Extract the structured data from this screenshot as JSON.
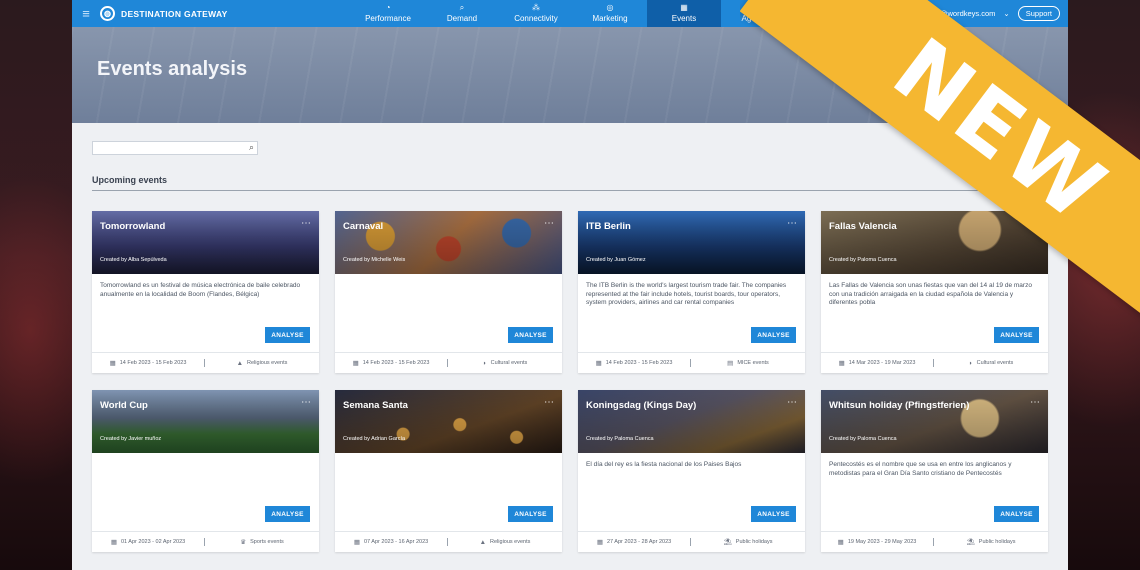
{
  "nav": {
    "brand": "DESTINATION GATEWAY",
    "items": [
      {
        "label": "Performance",
        "icon": "gauge-icon",
        "glyph": "◔"
      },
      {
        "label": "Demand",
        "icon": "search-icon",
        "glyph": "⌕"
      },
      {
        "label": "Connectivity",
        "icon": "network-icon",
        "glyph": "⁂"
      },
      {
        "label": "Marketing",
        "icon": "target-icon",
        "glyph": "◎"
      },
      {
        "label": "Events",
        "icon": "calendar-icon",
        "glyph": "▦"
      },
      {
        "label": "Agencies",
        "icon": "briefcase-icon",
        "glyph": "▤"
      }
    ],
    "active": "Events",
    "user_email": "info@wordkeys.com",
    "support_label": "Support"
  },
  "hero": {
    "title": "Events analysis"
  },
  "search": {
    "placeholder": "",
    "value": ""
  },
  "section": {
    "title": "Upcoming events"
  },
  "ribbon": {
    "text": "NEW",
    "color": "#f5b731"
  },
  "accent_color": "#1f87d8",
  "cards": [
    {
      "title": "Tomorrowland",
      "creator": "Created by Alba Sepúlveda",
      "desc": "Tomorrowland es un festival de música electrónica de baile celebrado anualmente en la localidad de Boom (Flandes, Bélgica)",
      "button": "ANALYSE",
      "date": "14 Feb 2023 - 15 Feb 2023",
      "category": "Religious events"
    },
    {
      "title": "Carnaval",
      "creator": "Created by Michelle Weis",
      "desc": "",
      "button": "ANALYSE",
      "date": "14 Feb 2023 - 15 Feb 2023",
      "category": "Cultural events"
    },
    {
      "title": "ITB Berlin",
      "creator": "Created by Juan Gómez",
      "desc": "The ITB Berlin is the world's largest tourism trade fair. The companies represented at the fair include hotels, tourist boards, tour operators, system providers, airlines and car rental companies",
      "button": "ANALYSE",
      "date": "14 Feb 2023 - 15 Feb 2023",
      "category": "MICE events"
    },
    {
      "title": "Fallas Valencia",
      "creator": "Created by Paloma Cuenca",
      "desc": "Las Fallas de Valencia son unas fiestas que van del 14 al 19 de marzo con una tradición arraigada en la ciudad española de Valencia y diferentes pobla",
      "button": "ANALYSE",
      "date": "14 Mar 2023 - 19 Mar 2023",
      "category": "Cultural events"
    },
    {
      "title": "World Cup",
      "creator": "Created by Javier muñoz",
      "desc": "",
      "button": "ANALYSE",
      "date": "01 Apr 2023 - 02 Apr 2023",
      "category": "Sports events"
    },
    {
      "title": "Semana Santa",
      "creator": "Created by Adrian García",
      "desc": "",
      "button": "ANALYSE",
      "date": "07 Apr 2023 - 16 Apr 2023",
      "category": "Religious events"
    },
    {
      "title": "Koningsdag (Kings Day)",
      "creator": "Created by Paloma Cuenca",
      "desc": "El día del rey es la fiesta nacional de los Paises Bajos",
      "button": "ANALYSE",
      "date": "27 Apr 2023 - 28 Apr 2023",
      "category": "Public holidays"
    },
    {
      "title": "Whitsun holiday (Pfingstferien)",
      "creator": "Created by Paloma Cuenca",
      "desc": "Pentecostés es el nombre que se usa en entre los anglicanos y metodistas para el Gran Día Santo cristiano de Pentecostés",
      "button": "ANALYSE",
      "date": "19 May 2023 - 29 May 2023",
      "category": "Public holidays"
    }
  ]
}
